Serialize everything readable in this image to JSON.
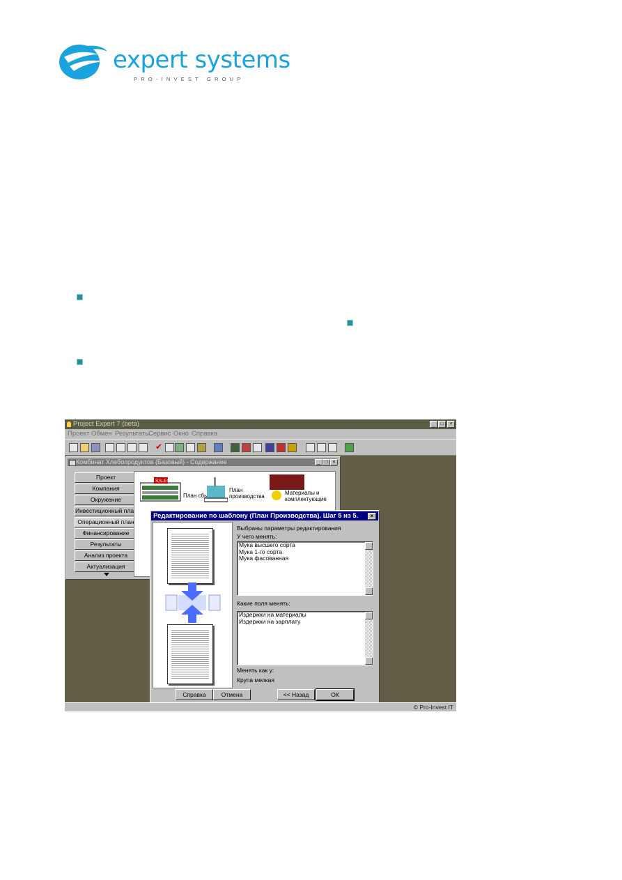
{
  "logo": {
    "name": "expert systems",
    "tagline": "PRO-INVEST GROUP",
    "color": "#1aa3dc"
  },
  "app": {
    "title": "Project Expert 7 (beta)",
    "menu": [
      "Проект",
      "Обмен",
      "Результаты",
      "Сервис",
      "Окно",
      "Справка"
    ],
    "status_text": "© Pro-Invest IT",
    "window_controls": [
      "_",
      "□",
      "×"
    ]
  },
  "doc_window": {
    "title": "Комбинат Хлебопродуктов (Базовый) - Содержание",
    "nav_items": [
      "Проект",
      "Компания",
      "Окружение",
      "Инвестиционный план",
      "Операционный план",
      "Финансирование",
      "Результаты",
      "Анализ проекта",
      "Актуализация"
    ],
    "active_nav": "Операционный план",
    "content_icons": [
      {
        "icon": "sales-icon",
        "label": "План сбыта",
        "badge": "SALES"
      },
      {
        "icon": "factory-icon",
        "label": "План производства"
      },
      {
        "icon": "materials-icon",
        "label": "Материалы и комплектующие"
      }
    ]
  },
  "dialog": {
    "title": "Редактирование по шаблону (План Производства). Шаг 5 из 5.",
    "close_label": "×",
    "selected_params_label": "Выбраны параметры редактирования",
    "what_to_change_label": "У чего менять:",
    "what_items": [
      "Мука высшего сорта",
      "Мука 1-го сорта",
      "Мука фасованная"
    ],
    "which_fields_label": "Какие поля менять:",
    "field_items": [
      "Издержки на материалы",
      "Издержки на зарплату"
    ],
    "change_as_label": "Менять как у:",
    "change_as_value": "Крупа мелкая",
    "buttons": {
      "help": "Справка",
      "cancel": "Отмена",
      "back": "<< Назад",
      "ok": "ОК"
    }
  }
}
